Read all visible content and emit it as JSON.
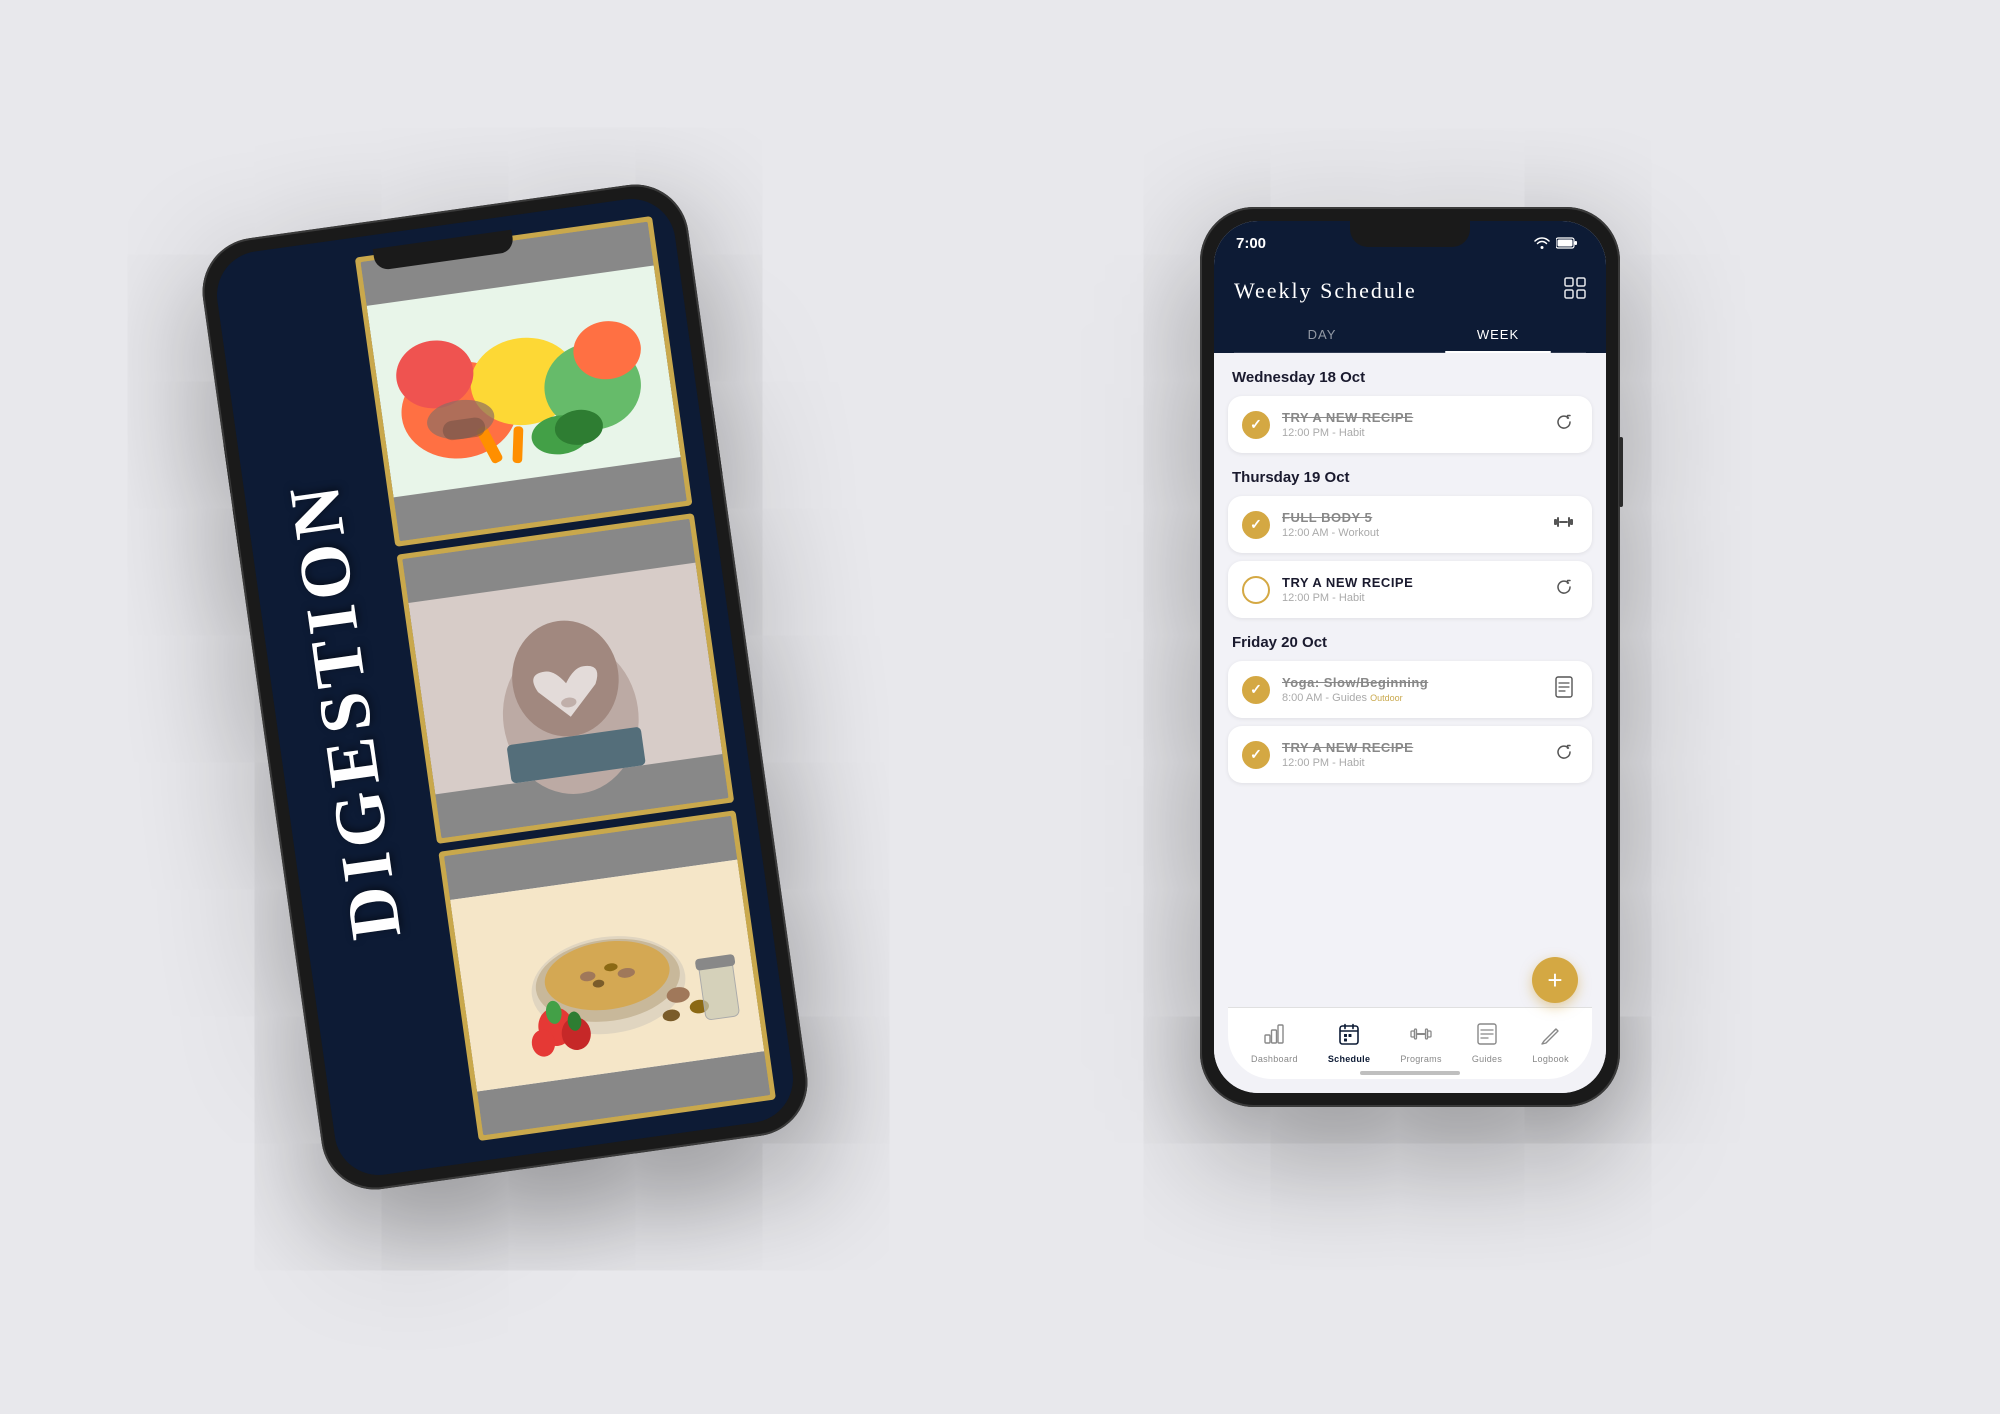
{
  "back_phone": {
    "title": "DIGESTION",
    "photos": [
      {
        "id": "fruits",
        "alt": "Fruits and vegetables"
      },
      {
        "id": "body",
        "alt": "Body heart hands"
      },
      {
        "id": "food",
        "alt": "Granola and berries"
      }
    ]
  },
  "front_phone": {
    "status": {
      "time": "7:00",
      "wifi": "wifi",
      "battery": "battery"
    },
    "header": {
      "title": "Weekly Schedule",
      "grid_icon": "⊞"
    },
    "tabs": [
      {
        "label": "DAY",
        "active": false
      },
      {
        "label": "WEEK",
        "active": true
      }
    ],
    "days": [
      {
        "id": "wed",
        "header": "Wednesday 18 Oct",
        "items": [
          {
            "id": "wed-1",
            "name": "TRY A NEW RECIPE",
            "time": "12:00 PM",
            "category": "Habit",
            "checked": true,
            "strikethrough": true,
            "icon": "refresh"
          }
        ]
      },
      {
        "id": "thu",
        "header": "Thursday 19 Oct",
        "items": [
          {
            "id": "thu-1",
            "name": "FULL BODY 5",
            "time": "12:00 AM",
            "category": "Workout",
            "checked": true,
            "strikethrough": true,
            "icon": "dumbbell"
          },
          {
            "id": "thu-2",
            "name": "TRY A NEW RECIPE",
            "time": "12:00 PM",
            "category": "Habit",
            "checked": false,
            "strikethrough": false,
            "icon": "refresh"
          }
        ]
      },
      {
        "id": "fri",
        "header": "Friday 20 Oct",
        "items": [
          {
            "id": "fri-1",
            "name": "Yoga: Slow/Beginning",
            "time": "8:00 AM",
            "category": "Guides",
            "hint": "Outdoor",
            "checked": true,
            "strikethrough": true,
            "icon": "document"
          },
          {
            "id": "fri-2",
            "name": "TRY A NEW RECIPE",
            "time": "12:00 PM",
            "category": "Habit",
            "checked": true,
            "strikethrough": true,
            "icon": "refresh"
          }
        ]
      }
    ],
    "nav": [
      {
        "id": "dashboard",
        "label": "Dashboard",
        "icon": "📊",
        "active": false
      },
      {
        "id": "schedule",
        "label": "Schedule",
        "icon": "📅",
        "active": true
      },
      {
        "id": "programs",
        "label": "Programs",
        "icon": "⊞",
        "active": false
      },
      {
        "id": "guides",
        "label": "Guides",
        "icon": "📖",
        "active": false
      },
      {
        "id": "logbook",
        "label": "Logbook",
        "icon": "✏️",
        "active": false
      }
    ],
    "fab_label": "+"
  }
}
